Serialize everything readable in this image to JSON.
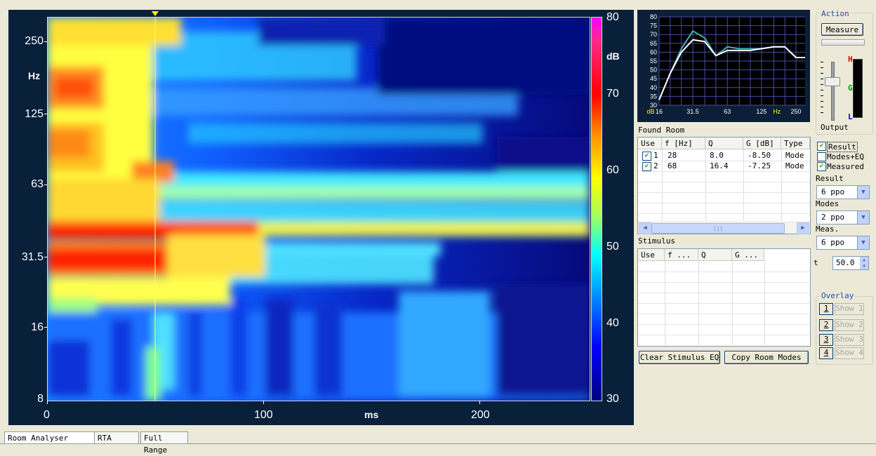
{
  "spectrogram": {
    "y_ticks": [
      "250",
      "125",
      "63",
      "31.5",
      "16",
      "8"
    ],
    "y_unit": "Hz",
    "x_ticks": [
      "0",
      "100",
      "200"
    ],
    "x_unit": "ms",
    "colorbar_ticks": [
      "80",
      "70",
      "60",
      "50",
      "40",
      "30"
    ],
    "colorbar_unit": "dB"
  },
  "mini_chart": {
    "y_ticks": [
      "80",
      "75",
      "70",
      "65",
      "60",
      "55",
      "50",
      "45",
      "40",
      "35",
      "30"
    ],
    "x_ticks": [
      "dB",
      "16",
      "31.5",
      "63",
      "125",
      "Hz",
      "250"
    ],
    "colors": {
      "background": "#000000",
      "grid": "#4a4aa0",
      "teal_curve": "#40b0b0",
      "white_curve": "#ffffff"
    }
  },
  "chart_data": {
    "type": "line",
    "title": "",
    "xlabel": "Hz",
    "ylabel": "dB",
    "x": [
      16,
      20,
      25,
      31.5,
      40,
      50,
      63,
      80,
      100,
      125,
      160,
      200,
      250,
      300
    ],
    "ylim": [
      30,
      80
    ],
    "series": [
      {
        "values": [
          33,
          48,
          62,
          72,
          68,
          58,
          63,
          62,
          62,
          62,
          63,
          63,
          57,
          57
        ]
      },
      {
        "values": [
          33,
          48,
          60,
          67,
          66,
          58,
          61,
          61,
          61,
          62,
          63,
          63,
          57,
          57
        ]
      }
    ]
  },
  "action": {
    "title": "Action",
    "measure_label": "Measure",
    "output_label": "Output",
    "meter_labels": [
      "H",
      "G",
      "L"
    ]
  },
  "found_room": {
    "title": "Found Room",
    "columns": [
      "Use",
      "f [Hz]",
      "Q",
      "G [dB]",
      "Type"
    ],
    "rows": [
      {
        "use": "1",
        "f": "28",
        "q": "8.0",
        "g": "-8.50",
        "type": "Mode"
      },
      {
        "use": "2",
        "f": "68",
        "q": "16.4",
        "g": "-7.25",
        "type": "Mode"
      }
    ]
  },
  "options": {
    "result": "Result",
    "modes_eq": "Modes+EQ",
    "measured": "Measured",
    "result_label": "Result",
    "result_value": "6 ppo",
    "modes_label": "Modes",
    "modes_value": "2 ppo",
    "meas_label": "Meas.",
    "meas_value": "6 ppo",
    "t_label": "t",
    "t_value": "50.0"
  },
  "stimulus": {
    "title": "Stimulus",
    "columns": [
      "Use",
      "f ...",
      "Q",
      "G ..."
    ]
  },
  "buttons": {
    "clear_stimulus": "Clear Stimulus EQ",
    "copy_room_modes": "Copy Room Modes"
  },
  "overlay": {
    "title": "Overlay",
    "items": [
      {
        "num": "1",
        "show": "Show 1"
      },
      {
        "num": "2",
        "show": "Show 2"
      },
      {
        "num": "3",
        "show": "Show 3"
      },
      {
        "num": "4",
        "show": "Show 4"
      }
    ]
  },
  "tabs": [
    "Room Analyser",
    "RTA",
    "Full Range"
  ]
}
